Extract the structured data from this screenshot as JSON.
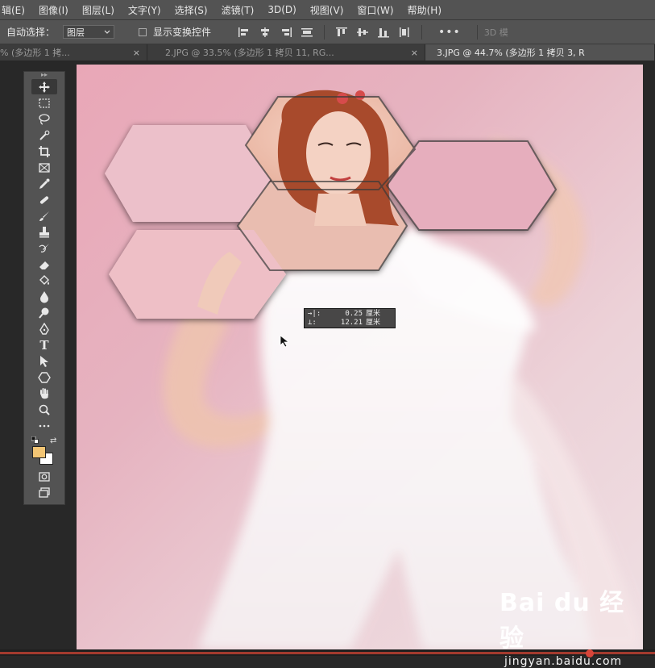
{
  "menubar": {
    "items": [
      "辑(E)",
      "图像(I)",
      "图层(L)",
      "文字(Y)",
      "选择(S)",
      "滤镜(T)",
      "3D(D)",
      "视图(V)",
      "窗口(W)",
      "帮助(H)"
    ]
  },
  "options": {
    "auto_select_label": "自动选择：",
    "auto_select_value": "图层",
    "show_transform_label": "显示变换控件",
    "more_label": "•••",
    "mode_3d_label": "3D 模"
  },
  "tabs": [
    {
      "label": "% (多边形 1 拷...",
      "close": "×"
    },
    {
      "label": "2.JPG @ 33.5% (多边形 1 拷贝 11, RG...",
      "close": "×"
    },
    {
      "label": "3.JPG @ 44.7% (多边形 1 拷贝 3, R",
      "close": ""
    }
  ],
  "toolbar": {
    "grip": "▸▸",
    "tools": [
      "move-icon",
      "marquee-icon",
      "lasso-icon",
      "quick-select-icon",
      "crop-icon",
      "frame-icon",
      "eyedropper-icon",
      "healing-icon",
      "brush-icon",
      "stamp-icon",
      "history-brush-icon",
      "eraser-icon",
      "paint-bucket-icon",
      "blur-icon",
      "dodge-icon",
      "pen-icon",
      "type-icon",
      "path-select-icon",
      "shape-icon",
      "hand-icon",
      "zoom-icon",
      "more-tools-icon"
    ],
    "type_tool_glyph": "T",
    "foreground_color": "#f2c574",
    "background_color": "#ffffff"
  },
  "measure": {
    "rows": [
      {
        "key": "→|:",
        "value": "0.25",
        "unit": "厘米"
      },
      {
        "key": "⊥:",
        "value": "12.21",
        "unit": "厘米"
      }
    ]
  },
  "watermark": {
    "logo": "Bai du 经验",
    "sub": "jingyan.baidu.com"
  }
}
